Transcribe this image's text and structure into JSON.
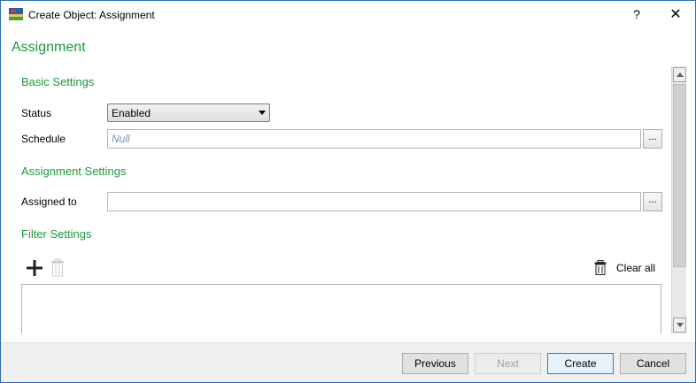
{
  "window": {
    "title": "Create Object: Assignment",
    "help_label": "?",
    "close_label": "✕"
  },
  "page_title": "Assignment",
  "basic_settings": {
    "title": "Basic Settings",
    "status_label": "Status",
    "status_value": "Enabled",
    "schedule_label": "Schedule",
    "schedule_placeholder": "Null",
    "schedule_button": "..."
  },
  "assignment_settings": {
    "title": "Assignment Settings",
    "assigned_to_label": "Assigned to",
    "assigned_to_value": "",
    "assigned_to_button": "..."
  },
  "filter_settings": {
    "title": "Filter Settings",
    "add_icon": "plus-icon",
    "delete_icon": "trash-icon",
    "clear_all_label": "Clear all"
  },
  "footer": {
    "previous": "Previous",
    "next": "Next",
    "create": "Create",
    "cancel": "Cancel"
  },
  "colors": {
    "section_green": "#1a9a3a",
    "placeholder_blue": "#6f8dc0",
    "primary_border": "#2b7bd6"
  }
}
